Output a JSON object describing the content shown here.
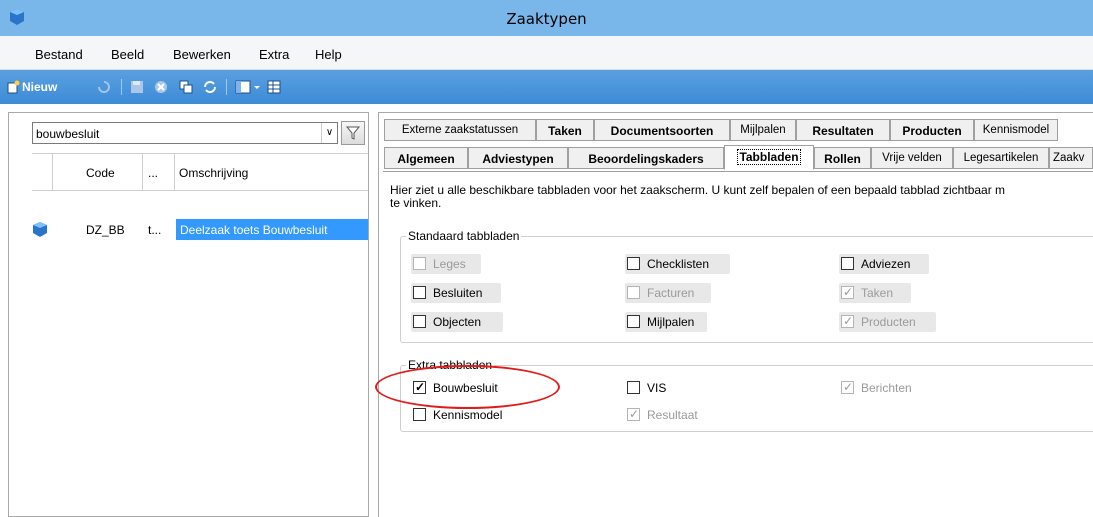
{
  "window": {
    "title": "Zaaktypen"
  },
  "menu": [
    "Bestand",
    "Beeld",
    "Bewerken",
    "Extra",
    "Help"
  ],
  "toolbar": {
    "new_label": "Nieuw"
  },
  "left": {
    "search_value": "bouwbesluit",
    "columns": [
      "Code",
      "...",
      "Omschrijving"
    ],
    "rows": [
      {
        "code": "DZ_BB",
        "dots": "t...",
        "omschrijving": "Deelzaak toets Bouwbesluit"
      }
    ]
  },
  "tabs_row1": [
    {
      "label": "Externe zaakstatussen",
      "bold": false
    },
    {
      "label": "Taken",
      "bold": true
    },
    {
      "label": "Documentsoorten",
      "bold": true
    },
    {
      "label": "Mijlpalen",
      "bold": false
    },
    {
      "label": "Resultaten",
      "bold": true
    },
    {
      "label": "Producten",
      "bold": true
    },
    {
      "label": "Kennismodel",
      "bold": false
    }
  ],
  "tabs_row2": [
    {
      "label": "Algemeen",
      "bold": true
    },
    {
      "label": "Adviestypen",
      "bold": true
    },
    {
      "label": "Beoordelingskaders",
      "bold": true
    },
    {
      "label": "Tabbladen",
      "bold": true,
      "selected": true
    },
    {
      "label": "Rollen",
      "bold": true
    },
    {
      "label": "Vrije velden",
      "bold": false
    },
    {
      "label": "Legesartikelen",
      "bold": false
    },
    {
      "label": "Zaakv",
      "bold": false
    }
  ],
  "description_line1": "Hier ziet u alle beschikbare tabbladen voor het zaakscherm. U kunt zelf bepalen of een bepaald tabblad zichtbaar m",
  "description_line2": "te vinken.",
  "standaard": {
    "title": "Standaard tabbladen",
    "items": [
      {
        "label": "Leges",
        "checked": false,
        "disabled": true
      },
      {
        "label": "Checklisten",
        "checked": false,
        "disabled": false
      },
      {
        "label": "Adviezen",
        "checked": false,
        "disabled": false
      },
      {
        "label": "Besluiten",
        "checked": false,
        "disabled": false
      },
      {
        "label": "Facturen",
        "checked": false,
        "disabled": true
      },
      {
        "label": "Taken",
        "checked": true,
        "disabled": true
      },
      {
        "label": "Objecten",
        "checked": false,
        "disabled": false
      },
      {
        "label": "Mijlpalen",
        "checked": false,
        "disabled": false
      },
      {
        "label": "Producten",
        "checked": true,
        "disabled": true
      }
    ]
  },
  "extra": {
    "title": "Extra tabbladen",
    "items": [
      {
        "label": "Bouwbesluit",
        "checked": true,
        "disabled": false
      },
      {
        "label": "VIS",
        "checked": false,
        "disabled": false
      },
      {
        "label": "Berichten",
        "checked": true,
        "disabled": true
      },
      {
        "label": "Kennismodel",
        "checked": false,
        "disabled": false
      },
      {
        "label": "Resultaat",
        "checked": true,
        "disabled": true
      }
    ]
  },
  "annotation_color": "#e01b1b"
}
